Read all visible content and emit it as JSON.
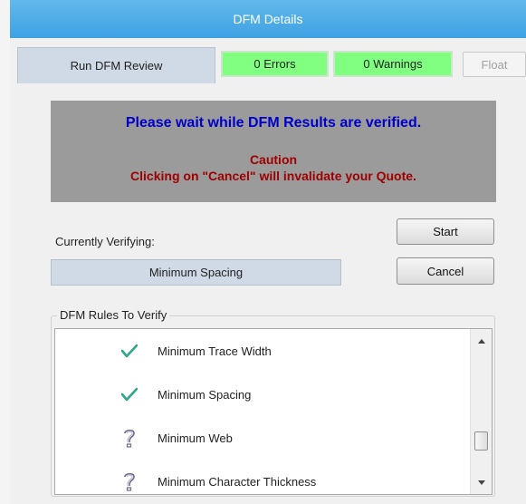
{
  "window": {
    "title": "DFM Details"
  },
  "toolbar": {
    "run_label": "Run DFM Review",
    "errors_label": "0 Errors",
    "warnings_label": "0 Warnings",
    "float_label": "Float"
  },
  "notice": {
    "wait_text": "Please wait while DFM Results are verified.",
    "caution_title": "Caution",
    "caution_text": "Clicking on \"Cancel\" will invalidate your Quote."
  },
  "verify": {
    "label": "Currently Verifying:",
    "current": "Minimum Spacing",
    "start_label": "Start",
    "cancel_label": "Cancel"
  },
  "rules": {
    "legend": "DFM Rules To Verify",
    "items": [
      {
        "label": "Minimum Trace Width",
        "status": "verified",
        "icon": "checkmark-icon"
      },
      {
        "label": "Minimum Spacing",
        "status": "verified",
        "icon": "checkmark-icon"
      },
      {
        "label": "Minimum Web",
        "status": "pending",
        "icon": "question-icon"
      },
      {
        "label": "Minimum Character Thickness",
        "status": "pending",
        "icon": "question-icon"
      }
    ]
  },
  "colors": {
    "titlebar": "#3ea2e3",
    "badge_ok": "#80ff80",
    "notice_bg": "#9b9b9b",
    "wait_text": "#0000c8",
    "caution_text": "#a00000",
    "check": "#2aa88c"
  }
}
